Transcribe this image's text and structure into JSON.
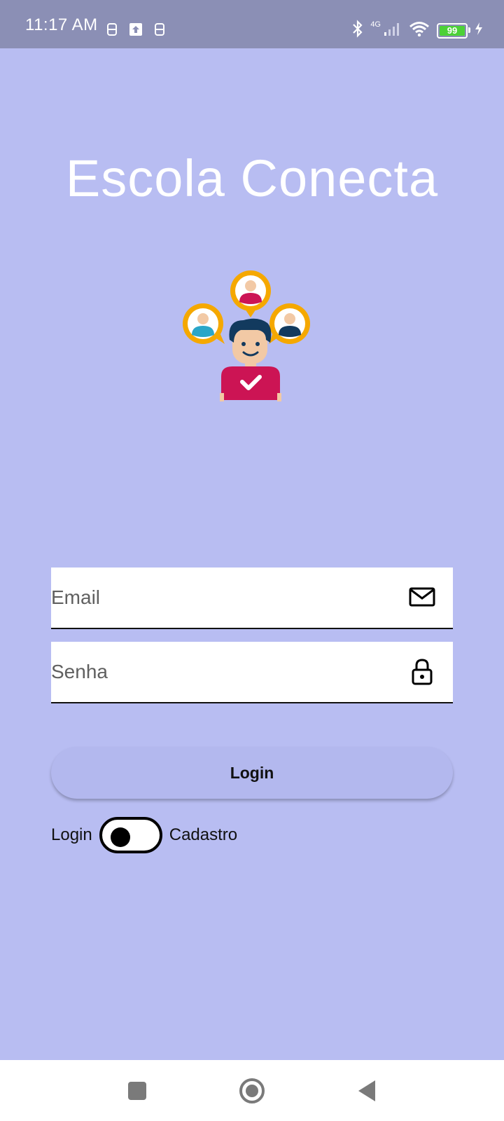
{
  "status_bar": {
    "time": "11:17 AM",
    "left_icons": [
      "sim-status-icon",
      "upload-icon",
      "sim-status-icon"
    ],
    "network_label": "4G",
    "battery_level": "99",
    "battery_color": "#4cd137",
    "right_icons": [
      "bluetooth-icon",
      "signal-icon",
      "wifi-icon",
      "battery-icon",
      "charging-icon"
    ]
  },
  "app": {
    "title": "Escola Conecta",
    "illustration": "connected-people-icon"
  },
  "form": {
    "email": {
      "placeholder": "Email",
      "value": "",
      "icon": "mail-icon"
    },
    "password": {
      "placeholder": "Senha",
      "value": "",
      "icon": "lock-icon"
    },
    "login_button": "Login",
    "toggle": {
      "left_label": "Login",
      "right_label": "Cadastro",
      "state": "off"
    }
  },
  "nav_bar": {
    "buttons": [
      "recents-icon",
      "home-icon",
      "back-icon"
    ]
  },
  "colors": {
    "background": "#b8bdf2",
    "status_bar": "#8b8fb5",
    "button": "#b3b8ee",
    "illustration_ring": "#f5a800",
    "illustration_shirt": "#cc1454"
  }
}
